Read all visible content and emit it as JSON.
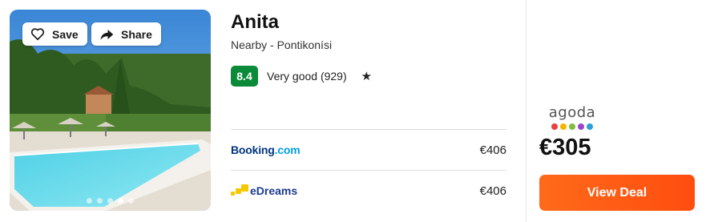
{
  "hotel": {
    "name": "Anita",
    "location": "Nearby - Pontikonísi",
    "score": "8.4",
    "rating_text": "Very good (929)",
    "star": "★"
  },
  "photo": {
    "save_label": "Save",
    "share_label": "Share",
    "save_icon": "heart-icon",
    "share_icon": "share-arrow-icon",
    "slides": 5,
    "active_slide": 4
  },
  "providers": [
    {
      "name_main": "Booking",
      "name_suffix": ".com",
      "price": "€406"
    },
    {
      "name_main": "eDreams",
      "price": "€406"
    }
  ],
  "best_deal": {
    "provider": "agoda",
    "price": "€305",
    "button_label": "View Deal"
  },
  "colors": {
    "score_bg": "#0b8a3a",
    "cta": "#ff5a14",
    "booking_blue": "#003580",
    "edreams_yellow": "#f6c800",
    "agoda_dots": [
      "#e8423f",
      "#f7b500",
      "#80bd41",
      "#9c46c6",
      "#2d9fd9"
    ]
  }
}
